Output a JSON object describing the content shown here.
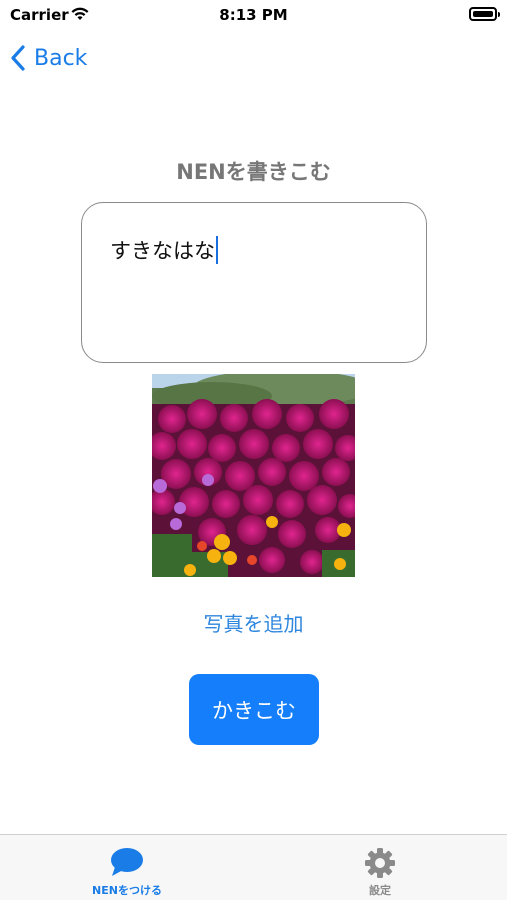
{
  "status_bar": {
    "carrier": "Carrier",
    "time": "8:13 PM"
  },
  "nav": {
    "back_label": "Back"
  },
  "main": {
    "title": "NENを書きこむ",
    "text_value": "すきなはな",
    "add_photo_label": "写真を追加",
    "submit_label": "かきこむ"
  },
  "tab_bar": {
    "tabs": [
      {
        "label": "NENをつける",
        "icon": "speech-bubble-icon",
        "selected": true
      },
      {
        "label": "設定",
        "icon": "gear-icon",
        "selected": false
      }
    ]
  },
  "colors": {
    "accent": "#147efb",
    "link": "#2e86de",
    "title_gray": "#777777"
  }
}
